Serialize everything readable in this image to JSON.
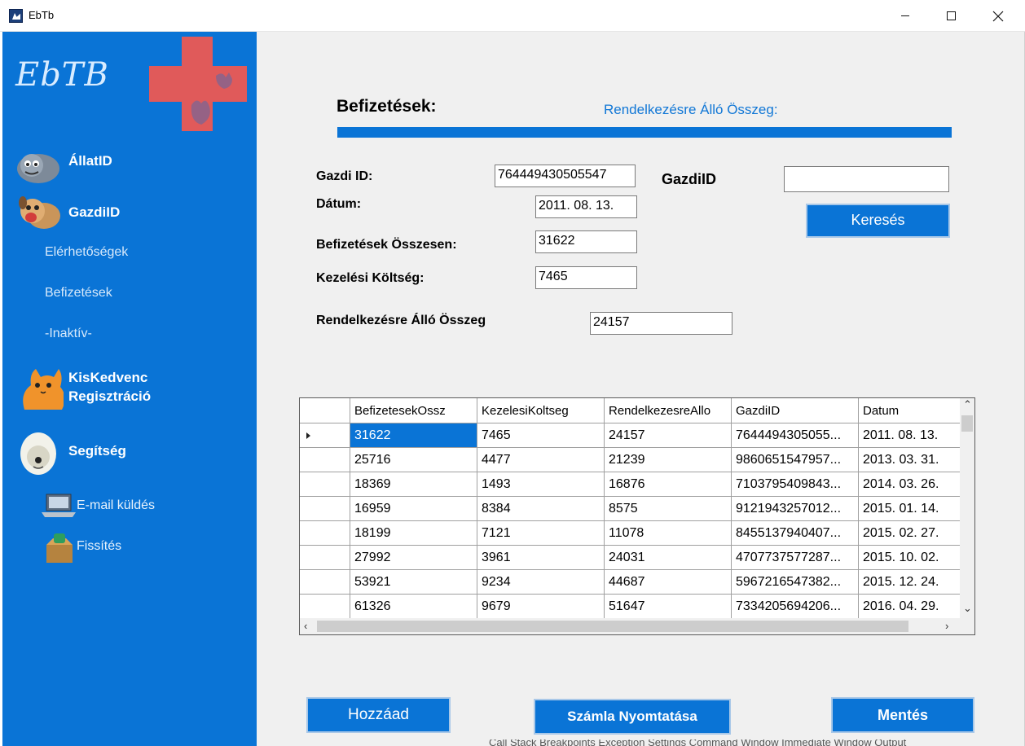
{
  "window": {
    "title": "EbTb"
  },
  "sidebar": {
    "logo_text": "EbTB",
    "nav": {
      "allat": "ÁllatID",
      "gazdi": "GazdiID",
      "elerhetosegek": "Elérhetőségek",
      "befizetesek": "Befizetések",
      "inaktiv": "-Inaktív-",
      "kiskedvenc_line1": "KisKedvenc",
      "kiskedvenc_line2": "Regisztráció",
      "segitseg": "Segítség",
      "email": "E-mail küldés",
      "frissites": "Fissítés"
    },
    "colors": {
      "background": "#0a74d6",
      "cross": "#e05a5a"
    }
  },
  "main": {
    "title": "Befizetések:",
    "subtitle": "Rendelkezésre Álló Összeg:",
    "form": {
      "gazdi_id_label": "Gazdi ID:",
      "gazdi_id_value": "764449430505547",
      "datum_label": "Dátum:",
      "datum_value": "2011. 08. 13.",
      "befizetesek_label": "Befizetések Összesen:",
      "befizetesek_value": "31622",
      "kezelesi_label": "Kezelési Költség:",
      "kezelesi_value": "7465",
      "rendelkezesre_label": "Rendelkezésre Álló Összeg",
      "rendelkezesre_value": "24157",
      "search_label": "GazdiID",
      "search_value": "",
      "search_button": "Keresés"
    },
    "grid": {
      "columns": [
        "BefizetesekOssz",
        "KezelesiKoltseg",
        "RendelkezesreAllo",
        "GazdiID",
        "Datum"
      ],
      "rows": [
        [
          "31622",
          "7465",
          "24157",
          "7644494305055...",
          "2011. 08. 13."
        ],
        [
          "25716",
          "4477",
          "21239",
          "9860651547957...",
          "2013. 03. 31."
        ],
        [
          "18369",
          "1493",
          "16876",
          "7103795409843...",
          "2014. 03. 26."
        ],
        [
          "16959",
          "8384",
          "8575",
          "9121943257012...",
          "2015. 01. 14."
        ],
        [
          "18199",
          "7121",
          "11078",
          "8455137940407...",
          "2015. 02. 27."
        ],
        [
          "27992",
          "3961",
          "24031",
          "4707737577287...",
          "2015. 10. 02."
        ],
        [
          "53921",
          "9234",
          "44687",
          "5967216547382...",
          "2015. 12. 24."
        ],
        [
          "61326",
          "9679",
          "51647",
          "7334205694206...",
          "2016. 04. 29."
        ]
      ]
    },
    "buttons": {
      "add": "Hozzáad",
      "print": "Számla Nyomtatása",
      "save": "Mentés"
    }
  },
  "background_strip": "Call Stack   Breakpoints   Exception Settings   Command Window   Immediate Window   Output"
}
